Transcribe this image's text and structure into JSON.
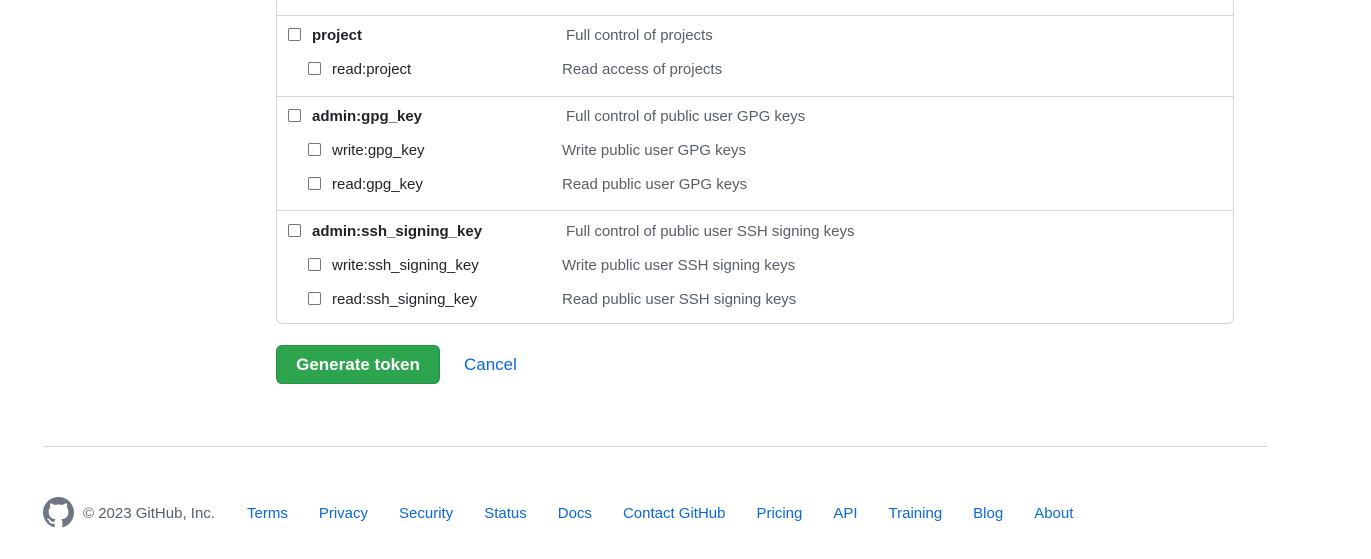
{
  "scopes": [
    {
      "name": "project",
      "description": "Full control of projects",
      "children": [
        {
          "name": "read:project",
          "description": "Read access of projects"
        }
      ]
    },
    {
      "name": "admin:gpg_key",
      "description": "Full control of public user GPG keys",
      "children": [
        {
          "name": "write:gpg_key",
          "description": "Write public user GPG keys"
        },
        {
          "name": "read:gpg_key",
          "description": "Read public user GPG keys"
        }
      ]
    },
    {
      "name": "admin:ssh_signing_key",
      "description": "Full control of public user SSH signing keys",
      "children": [
        {
          "name": "write:ssh_signing_key",
          "description": "Write public user SSH signing keys"
        },
        {
          "name": "read:ssh_signing_key",
          "description": "Read public user SSH signing keys"
        }
      ]
    }
  ],
  "actions": {
    "generate_label": "Generate token",
    "cancel_label": "Cancel"
  },
  "footer": {
    "copyright": "© 2023 GitHub, Inc.",
    "links": [
      "Terms",
      "Privacy",
      "Security",
      "Status",
      "Docs",
      "Contact GitHub",
      "Pricing",
      "API",
      "Training",
      "Blog",
      "About"
    ]
  },
  "colors": {
    "accent": "#0969da",
    "primary_button": "#2da44e",
    "border": "#d0d7de",
    "muted_text": "#57606a"
  }
}
